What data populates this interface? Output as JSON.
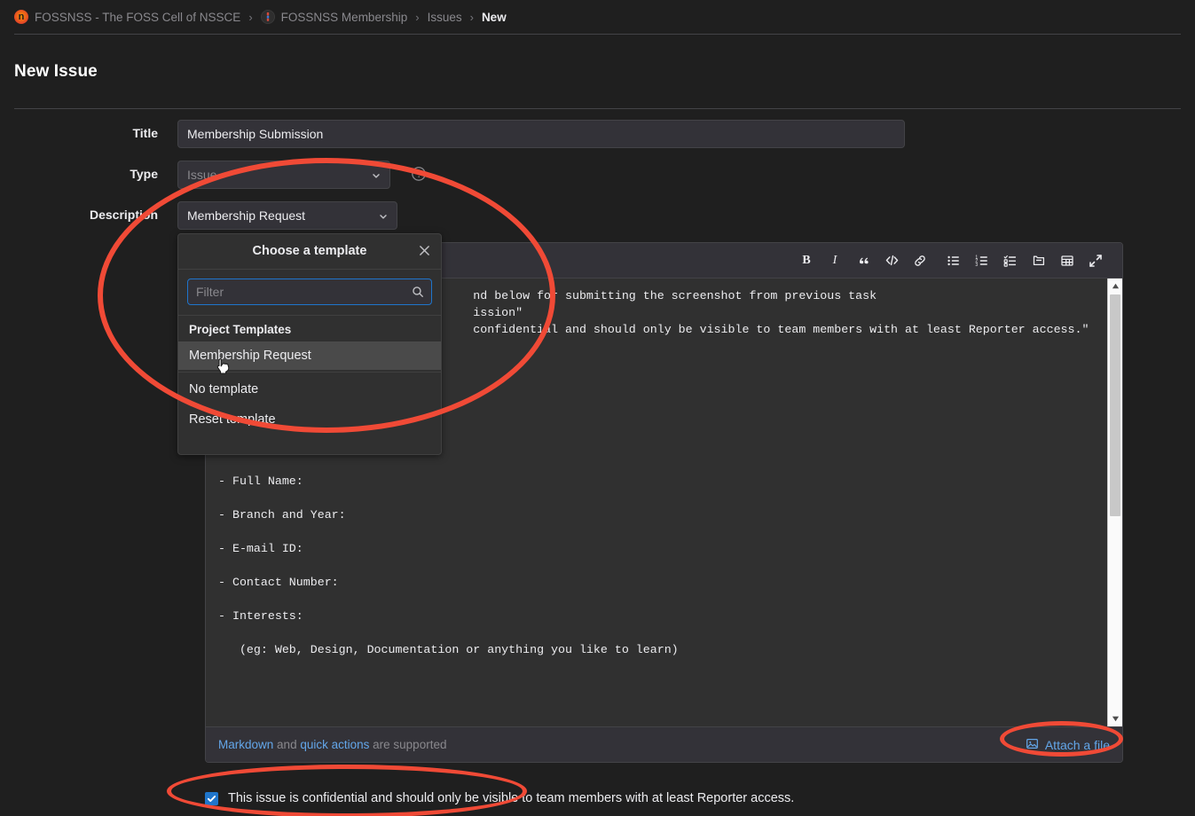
{
  "breadcrumb": {
    "items": [
      {
        "label": "FOSSNSS - The FOSS Cell of NSSCE",
        "icon": "org-avatar-icon",
        "type": "group"
      },
      {
        "label": "FOSSNSS Membership",
        "icon": "project-avatar-icon",
        "type": "project"
      },
      {
        "label": "Issues",
        "icon": "",
        "type": "section"
      },
      {
        "label": "New",
        "icon": "",
        "type": "current"
      }
    ],
    "separator": "›"
  },
  "page": {
    "title": "New Issue"
  },
  "form": {
    "title_label": "Title",
    "title_value": "Membership Submission",
    "title_placeholder": "Title",
    "type_label": "Type",
    "type_value": "Issue",
    "type_help_icon": "question-circle-icon",
    "description_label": "Description",
    "template_value": "Membership Request"
  },
  "template_dropdown": {
    "heading": "Choose a template",
    "close_icon": "close-icon",
    "filter_placeholder": "Filter",
    "filter_value": "",
    "search_icon": "search-icon",
    "group_label": "Project Templates",
    "items": [
      {
        "label": "Membership Request",
        "active": true
      }
    ],
    "no_template_label": "No template",
    "reset_template_label": "Reset template"
  },
  "editor": {
    "toolbar": [
      {
        "name": "bold-icon",
        "label": "B"
      },
      {
        "name": "italic-icon",
        "label": "I"
      },
      {
        "name": "quote-icon",
        "label": "”"
      },
      {
        "name": "code-icon",
        "label": "</>"
      },
      {
        "name": "link-icon",
        "label": "link"
      },
      {
        "name": "bullet-list-icon",
        "label": "bullet list"
      },
      {
        "name": "numbered-list-icon",
        "label": "numbered list"
      },
      {
        "name": "task-list-icon",
        "label": "task list"
      },
      {
        "name": "collapsible-section-icon",
        "label": "collapsible section"
      },
      {
        "name": "table-icon",
        "label": "table"
      },
      {
        "name": "fullscreen-icon",
        "label": "go full screen"
      }
    ],
    "content": "                                    nd below for submitting the screenshot from previous task\n                                    ission\"\n                                    confidential and should only be visible to team members with at least Reporter access.\"\n\n\n\n\n<br>\n<br>\n\n\n- Full Name:\n\n- Branch and Year:\n\n- E-mail ID:\n\n- Contact Number:\n\n- Interests:\n\n   (eg: Web, Design, Documentation or anything you like to learn)\n",
    "footer_markdown_link": "Markdown",
    "footer_and": "and",
    "footer_quick_actions_link": "quick actions",
    "footer_suffix": "are supported",
    "attach_label": "Attach a file",
    "attach_icon": "image-attach-icon"
  },
  "confidential": {
    "checked": true,
    "label": "This issue is confidential and should only be visible to team members with at least Reporter access."
  },
  "annotations": {
    "color": "#f04a36",
    "shapes": [
      {
        "name": "template-dropdown-highlight",
        "shape": "ellipse"
      },
      {
        "name": "attach-a-file-highlight",
        "shape": "ellipse"
      },
      {
        "name": "confidential-checkbox-highlight",
        "shape": "ellipse"
      }
    ]
  }
}
